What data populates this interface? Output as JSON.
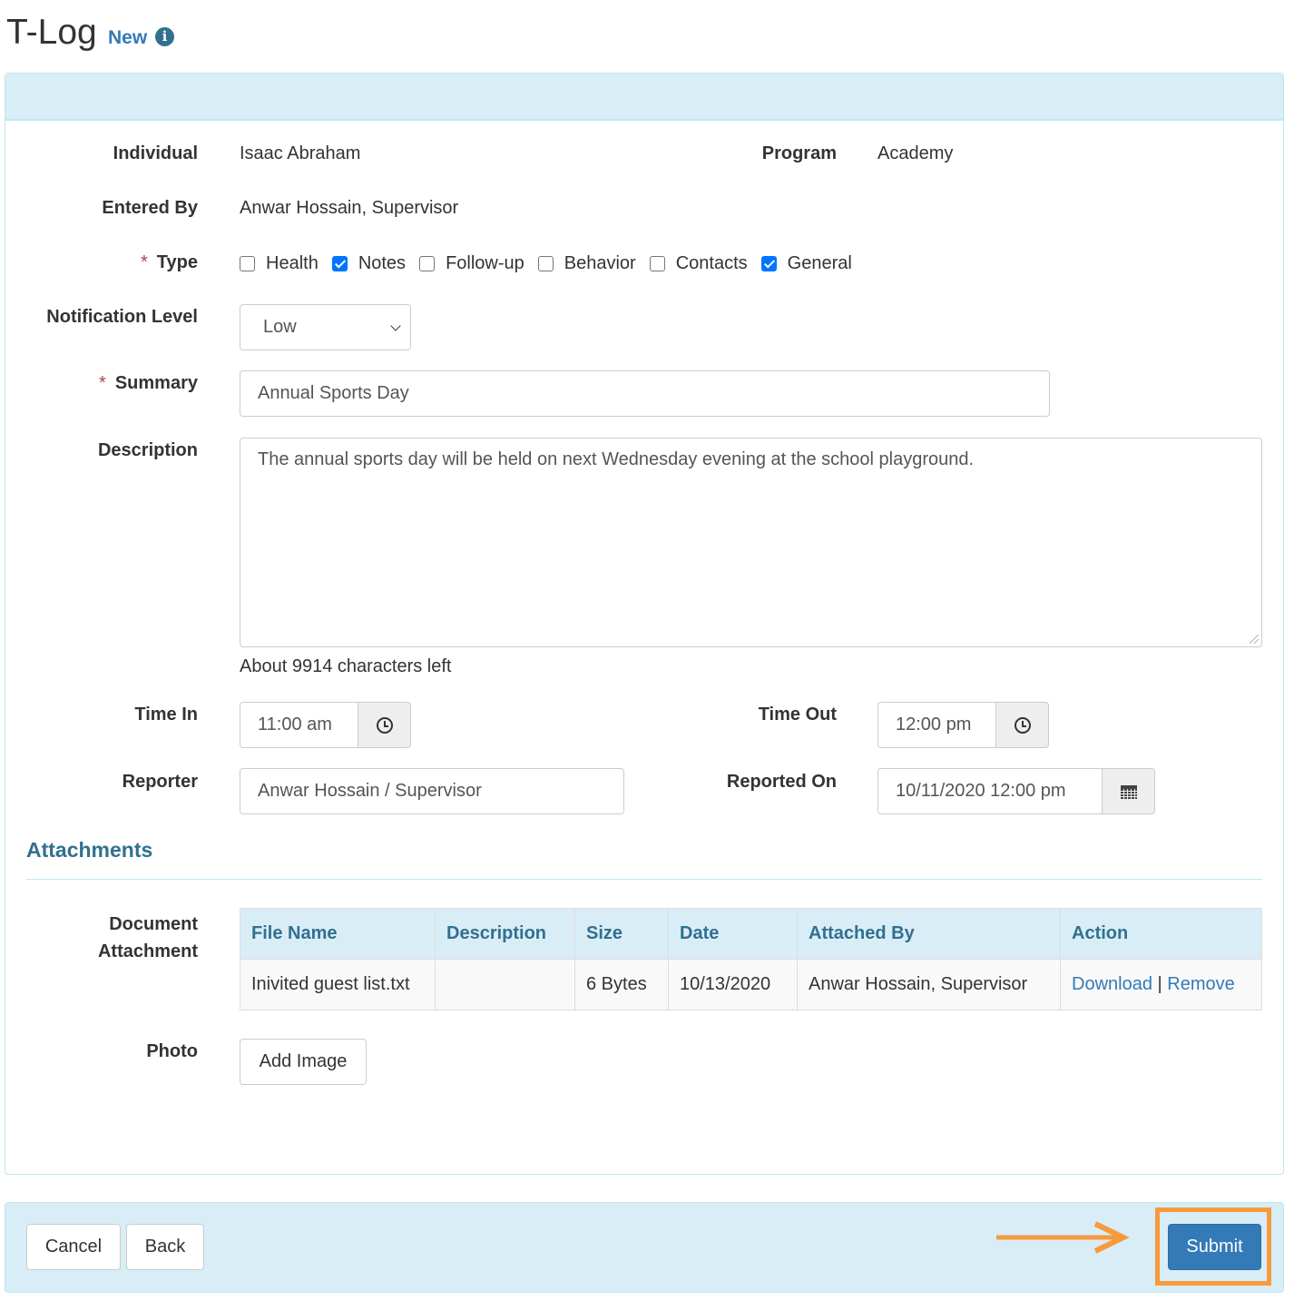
{
  "header": {
    "title": "T-Log",
    "mode": "New",
    "info_icon": "info-circle-icon"
  },
  "form": {
    "individual": {
      "label": "Individual",
      "value": "Isaac Abraham"
    },
    "program": {
      "label": "Program",
      "value": "Academy"
    },
    "entered_by": {
      "label": "Entered By",
      "value": "Anwar Hossain, Supervisor"
    },
    "type": {
      "label": "Type",
      "required_mark": "*",
      "options": [
        {
          "label": "Health",
          "checked": false
        },
        {
          "label": "Notes",
          "checked": true
        },
        {
          "label": "Follow-up",
          "checked": false
        },
        {
          "label": "Behavior",
          "checked": false
        },
        {
          "label": "Contacts",
          "checked": false
        },
        {
          "label": "General",
          "checked": true
        }
      ]
    },
    "notification_level": {
      "label": "Notification Level",
      "value": "Low"
    },
    "summary": {
      "label": "Summary",
      "required_mark": "*",
      "value": "Annual Sports Day"
    },
    "description": {
      "label": "Description",
      "value": "The annual sports day will be held on next Wednesday evening at the school playground.",
      "chars_left": "About 9914 characters left"
    },
    "time_in": {
      "label": "Time In",
      "value": "11:00 am",
      "icon": "clock-icon"
    },
    "time_out": {
      "label": "Time Out",
      "value": "12:00 pm",
      "icon": "clock-icon"
    },
    "reporter": {
      "label": "Reporter",
      "value": "Anwar Hossain / Supervisor"
    },
    "reported_on": {
      "label": "Reported On",
      "value": "10/11/2020 12:00 pm",
      "icon": "calendar-icon"
    }
  },
  "attachments": {
    "title": "Attachments",
    "document_label_line1": "Document",
    "document_label_line2": "Attachment",
    "columns": [
      "File Name",
      "Description",
      "Size",
      "Date",
      "Attached By",
      "Action"
    ],
    "rows": [
      {
        "file_name": "Inivited guest list.txt",
        "description": "",
        "size": "6 Bytes",
        "date": "10/13/2020",
        "attached_by": "Anwar Hossain, Supervisor",
        "download": "Download",
        "separator": "|",
        "remove": "Remove"
      }
    ],
    "photo_label": "Photo",
    "add_image_label": "Add Image"
  },
  "footer": {
    "cancel": "Cancel",
    "back": "Back",
    "submit": "Submit"
  },
  "annotation": {
    "color": "#f79a3e",
    "target": "Submit"
  },
  "colors": {
    "primary": "#337ab7",
    "panel_bg": "#d9edf7",
    "panel_border": "#bce8f1",
    "heading": "#31708f",
    "checkbox": "#0075ff"
  }
}
